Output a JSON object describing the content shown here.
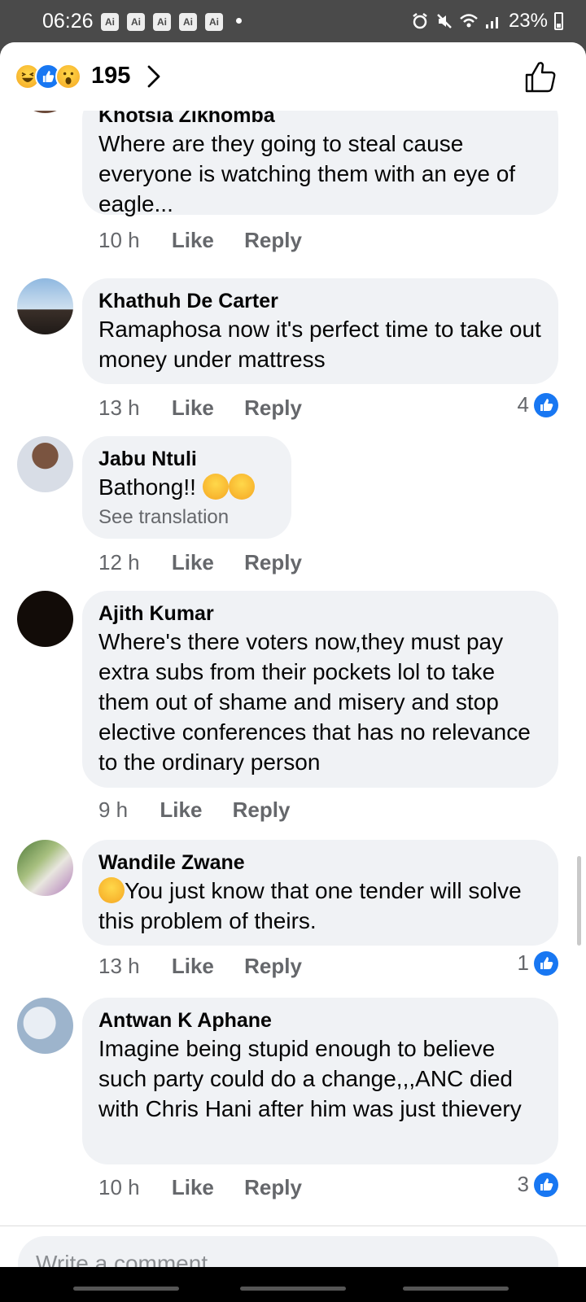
{
  "status_bar": {
    "time": "06:26",
    "ai_badges": [
      "Ai",
      "Ai",
      "Ai",
      "Ai",
      "Ai"
    ],
    "battery": "23%",
    "icons": [
      "alarm-icon",
      "mute-icon",
      "wifi-icon",
      "signal-icon",
      "battery-icon"
    ]
  },
  "header": {
    "reactions": [
      "haha-reaction-icon",
      "like-reaction-icon",
      "wow-reaction-icon"
    ],
    "reaction_count": "195",
    "accent_color": "#1877f2"
  },
  "comments": [
    {
      "name": "Khotsia Zikhomba",
      "text": "Where are they going to steal cause everyone is watching them with an eye of eagle...",
      "time": "10 h",
      "like_label": "Like",
      "reply_label": "Reply",
      "like_count": ""
    },
    {
      "name": "Khathuh De Carter",
      "text": "Ramaphosa now it's perfect time to take out money under mattress",
      "time": "13 h",
      "like_label": "Like",
      "reply_label": "Reply",
      "like_count": "4"
    },
    {
      "name": "Jabu Ntuli",
      "text": "Bathong!!",
      "translation": "See translation",
      "time": "12 h",
      "like_label": "Like",
      "reply_label": "Reply",
      "like_count": ""
    },
    {
      "name": "Ajith Kumar",
      "text": "Where's there voters now,they must pay extra subs from their pockets lol to take them out of shame and misery and stop elective conferences that has no relevance to the ordinary person",
      "time": "9 h",
      "like_label": "Like",
      "reply_label": "Reply",
      "like_count": ""
    },
    {
      "name": "Wandile Zwane",
      "text": "You just know that one tender will solve this problem of theirs.",
      "time": "13 h",
      "like_label": "Like",
      "reply_label": "Reply",
      "like_count": "1"
    },
    {
      "name": "Antwan K Aphane",
      "text": "Imagine being stupid enough to believe such party could do a change,,,ANC died with Chris Hani after him was just thievery",
      "time": "10 h",
      "like_label": "Like",
      "reply_label": "Reply",
      "like_count": "3"
    }
  ],
  "composer": {
    "placeholder": "Write a comment..."
  }
}
